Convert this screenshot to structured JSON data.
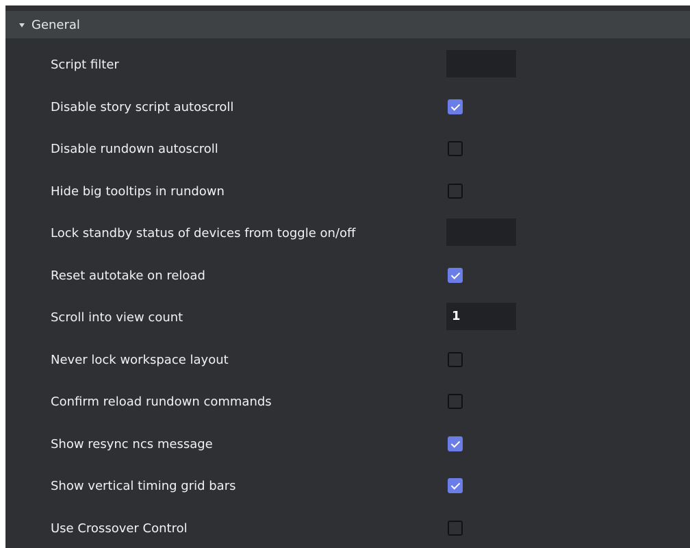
{
  "section": {
    "title": "General",
    "expanded": true
  },
  "settings": [
    {
      "label": "Script filter",
      "control": "text",
      "value": ""
    },
    {
      "label": "Disable story script autoscroll",
      "control": "checkbox",
      "checked": true
    },
    {
      "label": "Disable rundown autoscroll",
      "control": "checkbox",
      "checked": false
    },
    {
      "label": "Hide big tooltips in rundown",
      "control": "checkbox",
      "checked": false
    },
    {
      "label": "Lock standby status of devices from toggle on/off",
      "control": "text",
      "value": ""
    },
    {
      "label": "Reset autotake on reload",
      "control": "checkbox",
      "checked": true
    },
    {
      "label": "Scroll into view count",
      "control": "text",
      "value": "1"
    },
    {
      "label": "Never lock workspace layout",
      "control": "checkbox",
      "checked": false
    },
    {
      "label": "Confirm reload rundown commands",
      "control": "checkbox",
      "checked": false
    },
    {
      "label": "Show resync ncs message",
      "control": "checkbox",
      "checked": true
    },
    {
      "label": "Show vertical timing grid bars",
      "control": "checkbox",
      "checked": true
    },
    {
      "label": "Use Crossover Control",
      "control": "checkbox",
      "checked": false
    }
  ],
  "colors": {
    "panel_background": "#2e3033",
    "header_background": "#3f4245",
    "checkbox_checked": "#6b7de6",
    "input_background": "#202225",
    "text": "#f2f2f2"
  },
  "icons": {
    "expand": "triangle-down-icon",
    "check": "checkmark-icon"
  }
}
